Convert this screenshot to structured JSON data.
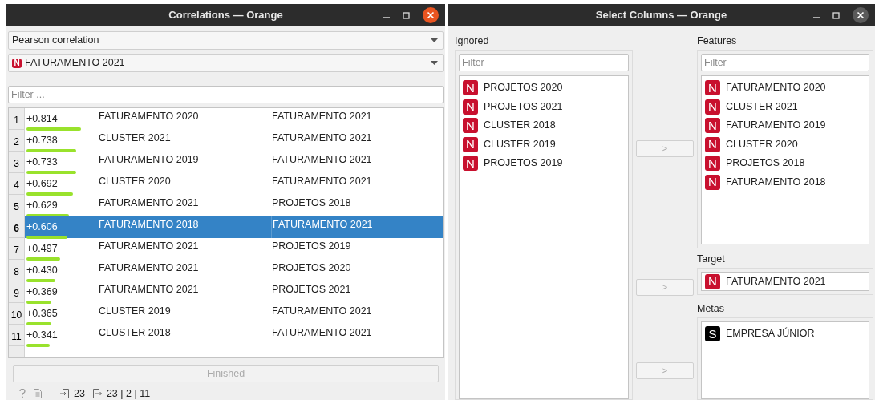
{
  "correlations_window": {
    "title": "Correlations — Orange",
    "correlation_type": "Pearson correlation",
    "feature": {
      "badge": "N",
      "kind": "numeric",
      "label": "FATURAMENTO 2021"
    },
    "filter": {
      "placeholder": "Filter ..."
    },
    "rows": [
      {
        "index": "1",
        "value": "+0.814",
        "feature_a": "FATURAMENTO 2020",
        "feature_b": "FATURAMENTO 2021",
        "selected": false
      },
      {
        "index": "2",
        "value": "+0.738",
        "feature_a": "CLUSTER 2021",
        "feature_b": "FATURAMENTO 2021",
        "selected": false
      },
      {
        "index": "3",
        "value": "+0.733",
        "feature_a": "FATURAMENTO 2019",
        "feature_b": "FATURAMENTO 2021",
        "selected": false
      },
      {
        "index": "4",
        "value": "+0.692",
        "feature_a": "CLUSTER 2020",
        "feature_b": "FATURAMENTO 2021",
        "selected": false
      },
      {
        "index": "5",
        "value": "+0.629",
        "feature_a": "FATURAMENTO 2021",
        "feature_b": "PROJETOS 2018",
        "selected": false
      },
      {
        "index": "6",
        "value": "+0.606",
        "feature_a": "FATURAMENTO 2018",
        "feature_b": "FATURAMENTO 2021",
        "selected": true
      },
      {
        "index": "7",
        "value": "+0.497",
        "feature_a": "FATURAMENTO 2021",
        "feature_b": "PROJETOS 2019",
        "selected": false
      },
      {
        "index": "8",
        "value": "+0.430",
        "feature_a": "FATURAMENTO 2021",
        "feature_b": "PROJETOS 2020",
        "selected": false
      },
      {
        "index": "9",
        "value": "+0.369",
        "feature_a": "FATURAMENTO 2021",
        "feature_b": "PROJETOS 2021",
        "selected": false
      },
      {
        "index": "10",
        "value": "+0.365",
        "feature_a": "CLUSTER 2019",
        "feature_b": "FATURAMENTO 2021",
        "selected": false
      },
      {
        "index": "11",
        "value": "+0.341",
        "feature_a": "CLUSTER 2018",
        "feature_b": "FATURAMENTO 2021",
        "selected": false
      }
    ],
    "progress_button": {
      "label": "Finished",
      "disabled": true
    },
    "status_bar": {
      "input_count": "23",
      "output_summary": "23 | 2 | 11"
    }
  },
  "select_columns_window": {
    "title": "Select Columns — Orange",
    "ignored": {
      "label": "Ignored",
      "filter_placeholder": "Filter",
      "items": [
        {
          "badge": "N",
          "kind": "numeric",
          "label": "PROJETOS 2020"
        },
        {
          "badge": "N",
          "kind": "numeric",
          "label": "PROJETOS 2021"
        },
        {
          "badge": "N",
          "kind": "numeric",
          "label": "CLUSTER 2018"
        },
        {
          "badge": "N",
          "kind": "numeric",
          "label": "CLUSTER 2019"
        },
        {
          "badge": "N",
          "kind": "numeric",
          "label": "PROJETOS 2019"
        }
      ]
    },
    "features": {
      "label": "Features",
      "filter_placeholder": "Filter",
      "items": [
        {
          "badge": "N",
          "kind": "numeric",
          "label": "FATURAMENTO 2020"
        },
        {
          "badge": "N",
          "kind": "numeric",
          "label": "CLUSTER 2021"
        },
        {
          "badge": "N",
          "kind": "numeric",
          "label": "FATURAMENTO 2019"
        },
        {
          "badge": "N",
          "kind": "numeric",
          "label": "CLUSTER 2020"
        },
        {
          "badge": "N",
          "kind": "numeric",
          "label": "PROJETOS 2018"
        },
        {
          "badge": "N",
          "kind": "numeric",
          "label": "FATURAMENTO 2018"
        }
      ]
    },
    "target": {
      "label": "Target",
      "items": [
        {
          "badge": "N",
          "kind": "numeric",
          "label": "FATURAMENTO 2021"
        }
      ]
    },
    "metas": {
      "label": "Metas",
      "items": [
        {
          "badge": "S",
          "kind": "string",
          "label": "EMPRESA JÚNIOR"
        }
      ]
    },
    "move_buttons": [
      ">",
      ">",
      ">"
    ]
  }
}
